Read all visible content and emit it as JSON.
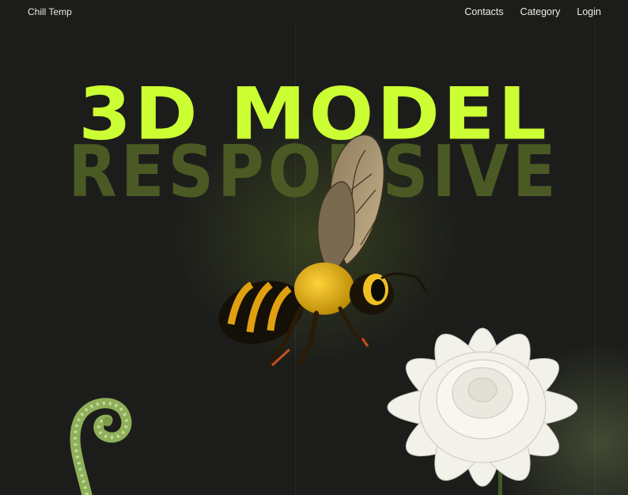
{
  "nav": {
    "brand": "Chill Temp",
    "links": [
      {
        "label": "Contacts"
      },
      {
        "label": "Category"
      },
      {
        "label": "Login"
      }
    ]
  },
  "hero": {
    "title": "3D MODEL",
    "subtitle": "RESPONSIVE"
  },
  "colors": {
    "accent": "#ccff33",
    "subtitle": "#4b5a24",
    "background": "#1c1d1b"
  },
  "images": {
    "bee": "bee-3d-model",
    "flower": "white-chrysanthemum",
    "fern": "fern-fiddlehead"
  }
}
